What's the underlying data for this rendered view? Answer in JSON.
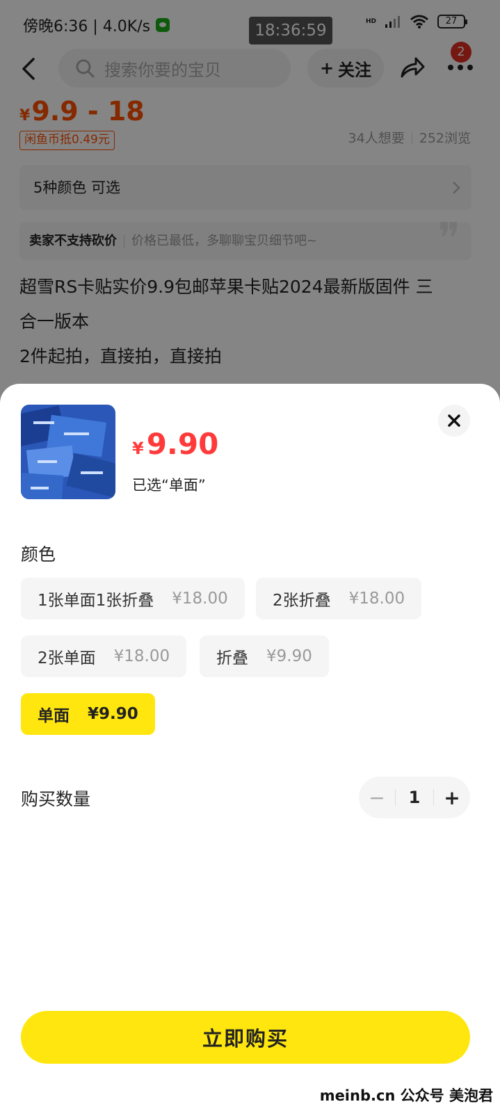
{
  "status_bar": {
    "left_text": "傍晚6:36 | 4.0K/s",
    "clock": "18:36:59",
    "hd_label": "HD",
    "battery": "27"
  },
  "nav": {
    "search_placeholder": "搜索你要的宝贝",
    "follow_label": "关注",
    "follow_plus": "+",
    "badge_count": "2"
  },
  "product": {
    "price_currency": "¥",
    "price_range": "9.9 - 18",
    "coin_tag": "闲鱼币抵0.49元",
    "wants": "34人想要",
    "views": "252浏览",
    "colors_row": "5种颜色 可选",
    "bargain_label": "卖家不支持砍价",
    "bargain_hint": "价格已最低，多聊聊宝贝细节吧~",
    "quote_mark": "❞",
    "description_lines": [
      "超雪RS卡贴实价9.9包邮苹果卡贴2024最新版固件 三",
      "合一版本",
      "2件起拍，直接拍，直接拍"
    ]
  },
  "sheet": {
    "price_currency": "¥",
    "price": "9.90",
    "selected_text": "已选“单面”",
    "color_label": "颜色",
    "options": [
      {
        "name": "1张单面1张折叠",
        "price": "¥18.00",
        "selected": false
      },
      {
        "name": "2张折叠",
        "price": "¥18.00",
        "selected": false
      },
      {
        "name": "2张单面",
        "price": "¥18.00",
        "selected": false
      },
      {
        "name": "折叠",
        "price": "¥9.90",
        "selected": false
      },
      {
        "name": "单面",
        "price": "¥9.90",
        "selected": true
      }
    ],
    "quantity_label": "购买数量",
    "quantity": "1",
    "minus": "−",
    "plus": "+",
    "buy_label": "立即购买"
  },
  "watermark": "meinb.cn  公众号 美泡君",
  "colors": {
    "accent_yellow": "#ffe60f",
    "price_red": "#ff3a3a",
    "price_orange": "#ff5000"
  }
}
